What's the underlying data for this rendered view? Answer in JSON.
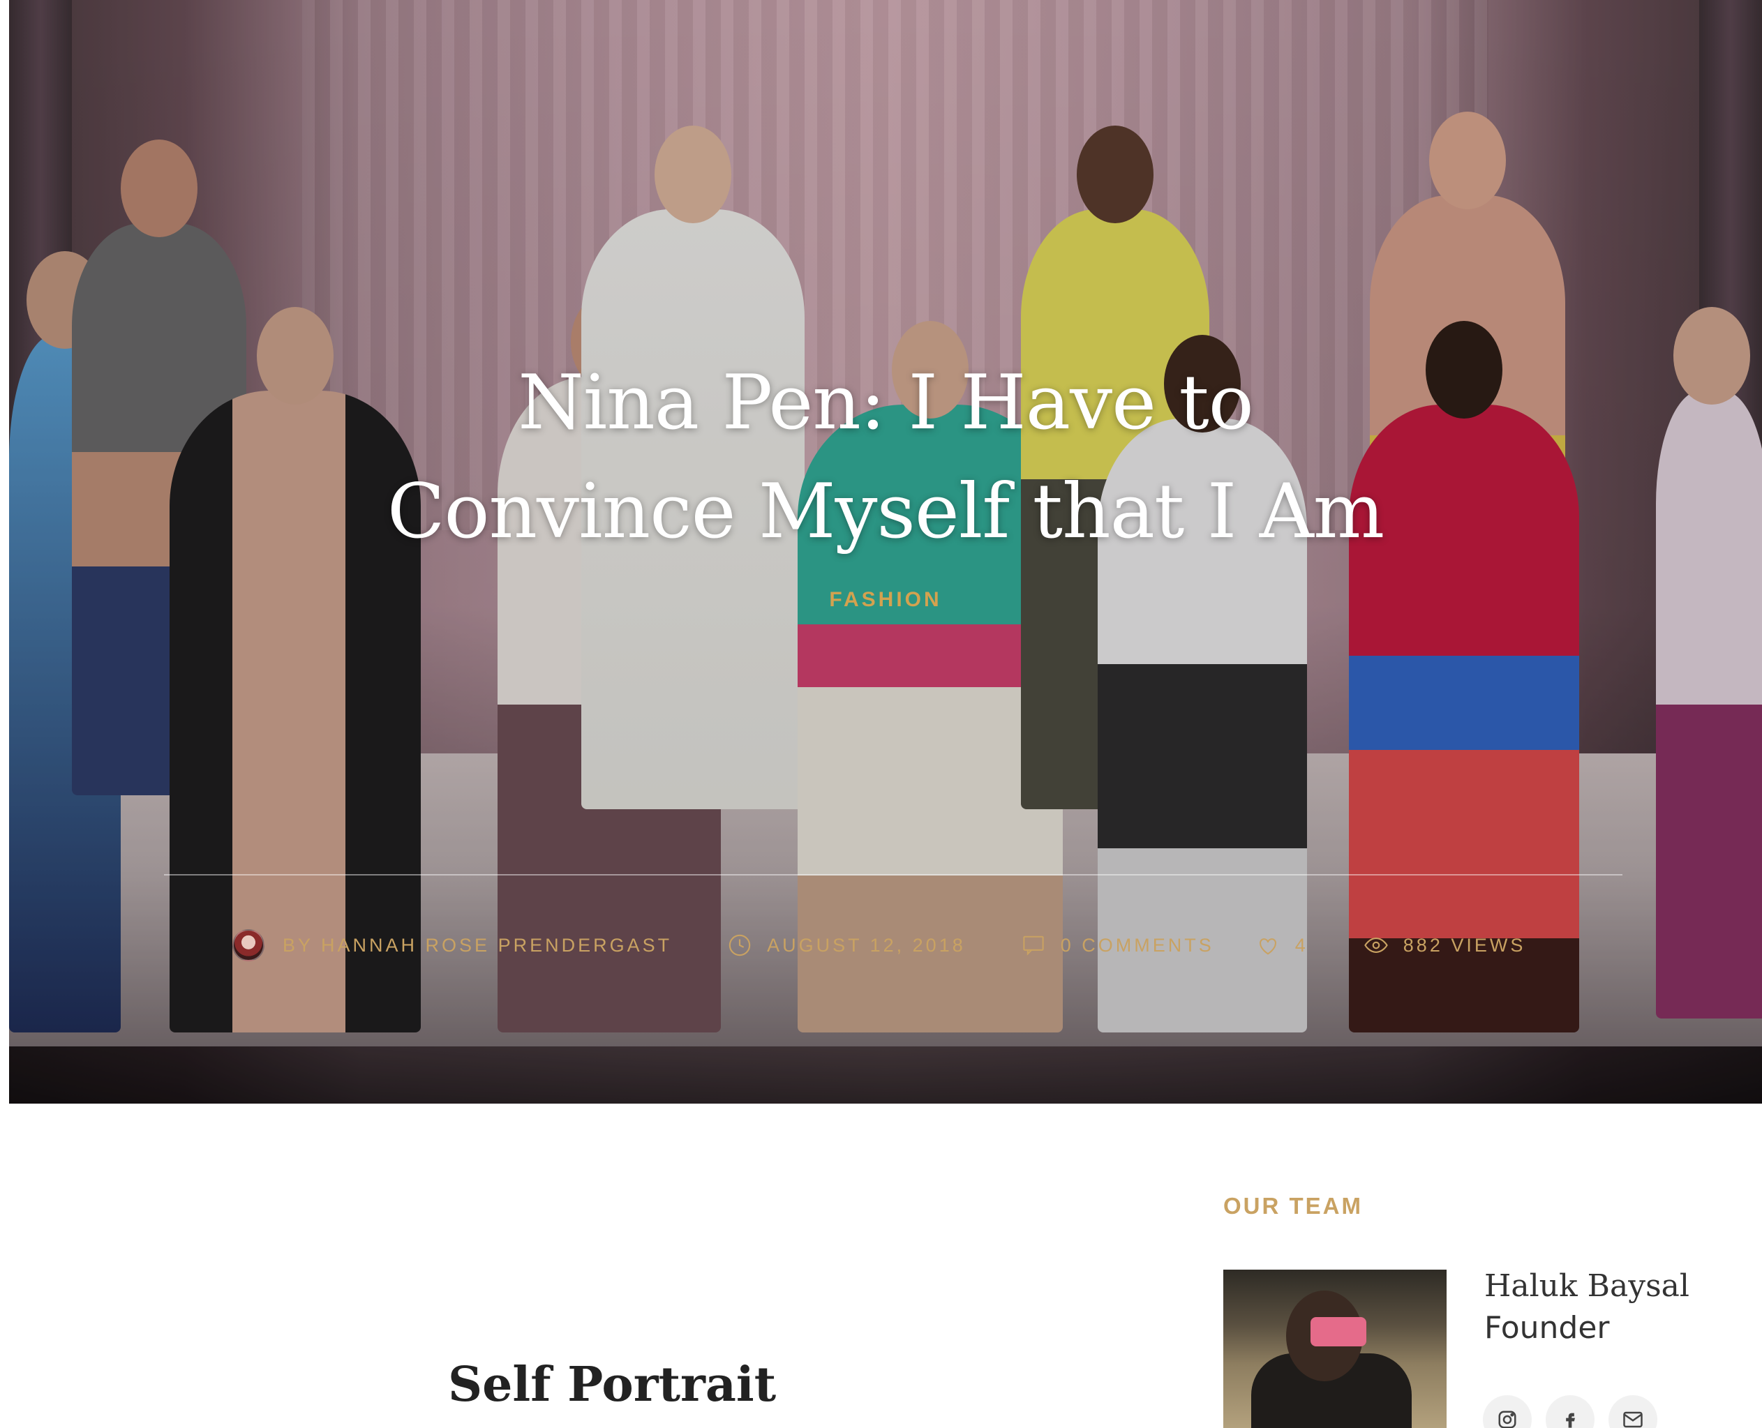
{
  "hero": {
    "title": "Nina Pen: I Have to Convince Myself that I Am",
    "category": "FASHION",
    "meta": {
      "author": "BY HANNAH ROSE PRENDERGAST",
      "date": "AUGUST 12, 2018",
      "comments": "0 COMMENTS",
      "likes": "4",
      "views": "882 VIEWS"
    }
  },
  "content": {
    "subheading": "Self Portrait"
  },
  "sidebar": {
    "widget_title": "OUR TEAM",
    "team_member": {
      "name": "Haluk Baysal",
      "role": "Founder",
      "social": [
        "instagram-icon",
        "facebook-icon",
        "email-icon"
      ]
    }
  },
  "colors": {
    "accent": "#c9a262",
    "category": "#d4a24f",
    "text": "#333333"
  }
}
